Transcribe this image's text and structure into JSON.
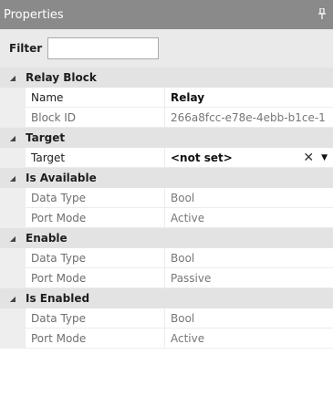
{
  "panel": {
    "title": "Properties",
    "pin_icon": "pin-icon"
  },
  "filter": {
    "label": "Filter",
    "value": ""
  },
  "groups": [
    {
      "title": "Relay Block",
      "rows": [
        {
          "name": "Name",
          "value": "Relay"
        },
        {
          "name": "Block ID",
          "value": "266a8fcc-e78e-4ebb-b1ce-1"
        }
      ]
    },
    {
      "title": "Target",
      "rows": [
        {
          "name": "Target",
          "value": "<not set>"
        }
      ]
    },
    {
      "title": "Is Available",
      "rows": [
        {
          "name": "Data Type",
          "value": "Bool"
        },
        {
          "name": "Port Mode",
          "value": "Active"
        }
      ]
    },
    {
      "title": "Enable",
      "rows": [
        {
          "name": "Data Type",
          "value": "Bool"
        },
        {
          "name": "Port Mode",
          "value": "Passive"
        }
      ]
    },
    {
      "title": "Is Enabled",
      "rows": [
        {
          "name": "Data Type",
          "value": "Bool"
        },
        {
          "name": "Port Mode",
          "value": "Active"
        }
      ]
    }
  ],
  "colors": {
    "titlebar": "#8a8a8a",
    "group_header": "#e3e3e3",
    "filterbar": "#eaeaea"
  }
}
